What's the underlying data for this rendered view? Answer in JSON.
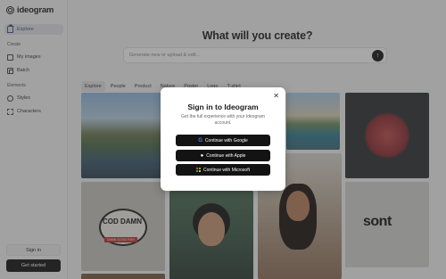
{
  "app": {
    "logo_text": "ideogram"
  },
  "sidebar": {
    "explore_label": "Explore",
    "create_section": "Create",
    "my_images_label": "My images",
    "batch_label": "Batch",
    "elements_section": "Elements",
    "styles_label": "Styles",
    "characters_label": "Characters",
    "sign_in_label": "Sign in",
    "get_started_label": "Get started"
  },
  "main": {
    "headline": "What will you create?",
    "prompt_placeholder": "Generate new or upload & edit...",
    "submit_icon": "↑",
    "tabs": [
      "Explore",
      "People",
      "Product",
      "Nature",
      "Poster",
      "Logo",
      "T-shirt"
    ]
  },
  "gallery": {
    "t4_brand": "COD DAMN",
    "t4_tagline": "DAMN GOOD FISH",
    "t7_brand": "sont"
  },
  "modal": {
    "title": "Sign in to Ideogram",
    "subtitle": "Get the full experience with your Ideogram account.",
    "close_glyph": "✕",
    "google_label": "Continue with Google",
    "apple_label": "Continue with Apple",
    "microsoft_label": "Continue with Microsoft"
  },
  "colors": {
    "accent": "#4a4a8a",
    "overlay": "#3c3c3c",
    "button_dark": "#131313"
  }
}
